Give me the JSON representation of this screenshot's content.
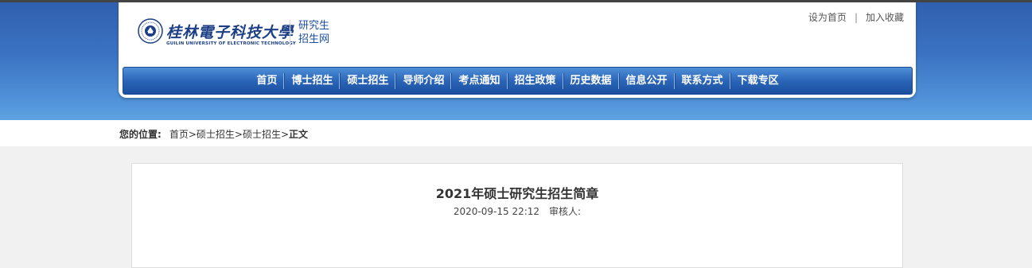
{
  "header": {
    "logo_cn": "桂林電子科技大學",
    "logo_en": "GUILIN UNIVERSITY OF ELECTRONIC TECHNOLOGY",
    "site_title_line1": "研究生",
    "site_title_line2": "招生网",
    "top_links": [
      "设为首页",
      "加入收藏"
    ],
    "top_links_separator": "|"
  },
  "nav": {
    "items": [
      "首页",
      "博士招生",
      "硕士招生",
      "导师介绍",
      "考点通知",
      "招生政策",
      "历史数据",
      "信息公开",
      "联系方式",
      "下载专区"
    ]
  },
  "breadcrumb": {
    "label": "您的位置:",
    "items": [
      "首页",
      "硕士招生",
      "硕士招生"
    ],
    "separator": ">",
    "current": "正文"
  },
  "article": {
    "title": "2021年硕士研究生招生简章",
    "datetime": "2020-09-15 22:12",
    "reviewer_label": "审核人:"
  },
  "colors": {
    "hero_blue": "#3b73c2",
    "nav_blue": "#2b65b8",
    "brand_text": "#1c4fa0"
  }
}
